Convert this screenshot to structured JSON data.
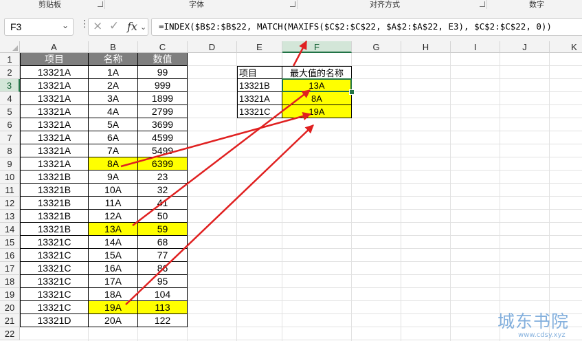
{
  "ribbon": {
    "groups": [
      {
        "label": "剪贴板"
      },
      {
        "label": "字体"
      },
      {
        "label": "对齐方式"
      },
      {
        "label": "数字"
      }
    ]
  },
  "formula_bar": {
    "name_box": "F3",
    "cancel_icon": "×",
    "enter_icon": "✓",
    "fx_label": "fx",
    "formula": "=INDEX($B$2:$B$22, MATCH(MAXIFS($C$2:$C$22, $A$2:$A$22, E3), $C$2:$C$22, 0))"
  },
  "columns": [
    "A",
    "B",
    "C",
    "D",
    "E",
    "F",
    "G",
    "H",
    "I",
    "J",
    "K"
  ],
  "rows": [
    "1",
    "2",
    "3",
    "4",
    "5",
    "6",
    "7",
    "8",
    "9",
    "10",
    "11",
    "12",
    "13",
    "14",
    "15",
    "16",
    "17",
    "18",
    "19",
    "20",
    "21",
    "22"
  ],
  "selected": {
    "column": "F",
    "row": "3"
  },
  "source_table": {
    "headers": [
      "项目",
      "名称",
      "数值"
    ],
    "rows": [
      [
        "13321A",
        "1A",
        "99"
      ],
      [
        "13321A",
        "2A",
        "999"
      ],
      [
        "13321A",
        "3A",
        "1899"
      ],
      [
        "13321A",
        "4A",
        "2799"
      ],
      [
        "13321A",
        "5A",
        "3699"
      ],
      [
        "13321A",
        "6A",
        "4599"
      ],
      [
        "13321A",
        "7A",
        "5499"
      ],
      [
        "13321A",
        "8A",
        "6399"
      ],
      [
        "13321B",
        "9A",
        "23"
      ],
      [
        "13321B",
        "10A",
        "32"
      ],
      [
        "13321B",
        "11A",
        "41"
      ],
      [
        "13321B",
        "12A",
        "50"
      ],
      [
        "13321B",
        "13A",
        "59"
      ],
      [
        "13321C",
        "14A",
        "68"
      ],
      [
        "13321C",
        "15A",
        "77"
      ],
      [
        "13321C",
        "16A",
        "86"
      ],
      [
        "13321C",
        "17A",
        "95"
      ],
      [
        "13321C",
        "18A",
        "104"
      ],
      [
        "13321C",
        "19A",
        "113"
      ],
      [
        "13321D",
        "20A",
        "122"
      ]
    ],
    "highlighted_rows": [
      7,
      12,
      18
    ]
  },
  "result_table": {
    "headers": [
      "项目",
      "最大值的名称"
    ],
    "rows": [
      [
        "13321B",
        "13A"
      ],
      [
        "13321A",
        "8A"
      ],
      [
        "13321C",
        "19A"
      ]
    ]
  },
  "colors": {
    "highlight": "#ffff00",
    "header_fill": "#7f7f7f",
    "selection": "#217346",
    "arrow": "#e02020"
  },
  "watermark": {
    "text": "城东书院",
    "url": "www.cdsy.xyz"
  }
}
